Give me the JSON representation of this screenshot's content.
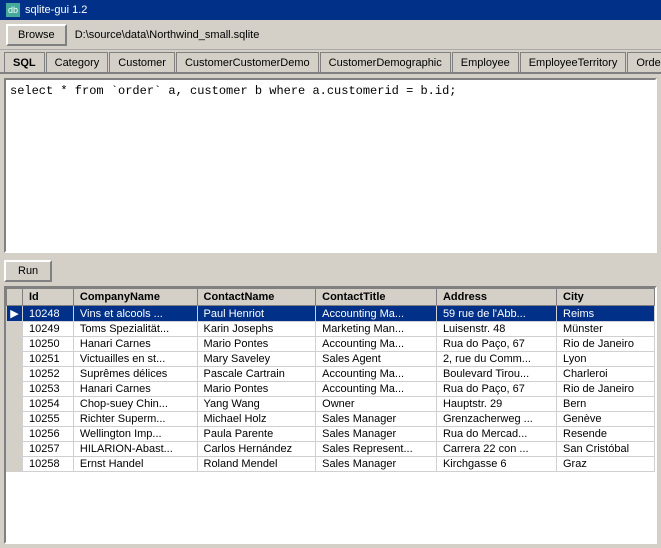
{
  "titleBar": {
    "icon": "db",
    "title": "sqlite-gui 1.2"
  },
  "toolbar": {
    "browseLabel": "Browse",
    "filePath": "D:\\source\\data\\Northwind_small.sqlite"
  },
  "tabs": [
    {
      "label": "SQL",
      "active": true
    },
    {
      "label": "Category",
      "active": false
    },
    {
      "label": "Customer",
      "active": false
    },
    {
      "label": "CustomerCustomerDemo",
      "active": false
    },
    {
      "label": "CustomerDemographic",
      "active": false
    },
    {
      "label": "Employee",
      "active": false
    },
    {
      "label": "EmployeeTerritory",
      "active": false
    },
    {
      "label": "Order",
      "active": false
    }
  ],
  "sqlEditor": {
    "value": "select * from `order` a, customer b where a.customerid = b.id;"
  },
  "runButton": {
    "label": "Run"
  },
  "tableHeaders": [
    "Id",
    "CompanyName",
    "ContactName",
    "ContactTitle",
    "Address",
    "City"
  ],
  "tableRows": [
    {
      "id": "10248",
      "companyName": "Vins et alcools ...",
      "contactName": "Paul Henriot",
      "contactTitle": "Accounting Ma...",
      "address": "59 rue de l'Abb...",
      "city": "Reims",
      "selected": true
    },
    {
      "id": "10249",
      "companyName": "Toms Spezialität...",
      "contactName": "Karin Josephs",
      "contactTitle": "Marketing Man...",
      "address": "Luisenstr. 48",
      "city": "Münster",
      "selected": false
    },
    {
      "id": "10250",
      "companyName": "Hanari Carnes",
      "contactName": "Mario Pontes",
      "contactTitle": "Accounting Ma...",
      "address": "Rua do Paço, 67",
      "city": "Rio de Janeiro",
      "selected": false
    },
    {
      "id": "10251",
      "companyName": "Victuailles en st...",
      "contactName": "Mary Saveley",
      "contactTitle": "Sales Agent",
      "address": "2, rue du Comm...",
      "city": "Lyon",
      "selected": false
    },
    {
      "id": "10252",
      "companyName": "Suprêmes délices",
      "contactName": "Pascale Cartrain",
      "contactTitle": "Accounting Ma...",
      "address": "Boulevard Tirou...",
      "city": "Charleroi",
      "selected": false
    },
    {
      "id": "10253",
      "companyName": "Hanari Carnes",
      "contactName": "Mario Pontes",
      "contactTitle": "Accounting Ma...",
      "address": "Rua do Paço, 67",
      "city": "Rio de Janeiro",
      "selected": false
    },
    {
      "id": "10254",
      "companyName": "Chop-suey Chin...",
      "contactName": "Yang Wang",
      "contactTitle": "Owner",
      "address": "Hauptstr. 29",
      "city": "Bern",
      "selected": false
    },
    {
      "id": "10255",
      "companyName": "Richter Superm...",
      "contactName": "Michael Holz",
      "contactTitle": "Sales Manager",
      "address": "Grenzacherweg ...",
      "city": "Genève",
      "selected": false
    },
    {
      "id": "10256",
      "companyName": "Wellington Imp...",
      "contactName": "Paula Parente",
      "contactTitle": "Sales Manager",
      "address": "Rua do Mercad...",
      "city": "Resende",
      "selected": false
    },
    {
      "id": "10257",
      "companyName": "HILARION-Abast...",
      "contactName": "Carlos Hernández",
      "contactTitle": "Sales Represent...",
      "address": "Carrera 22 con ...",
      "city": "San Cristóbal",
      "selected": false
    },
    {
      "id": "10258",
      "companyName": "Ernst Handel",
      "contactName": "Roland Mendel",
      "contactTitle": "Sales Manager",
      "address": "Kirchgasse 6",
      "city": "Graz",
      "selected": false
    }
  ]
}
